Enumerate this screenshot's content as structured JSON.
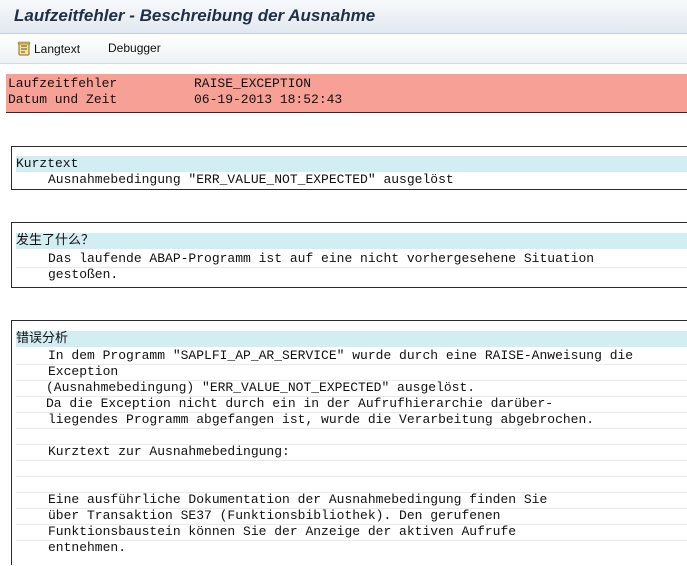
{
  "window": {
    "title": "Laufzeitfehler - Beschreibung der Ausnahme"
  },
  "toolbar": {
    "langtext_label": "Langtext",
    "debugger_label": "Debugger",
    "langtext_icon": "document-scroll-icon"
  },
  "header": {
    "runtime_error_label": "Laufzeitfehler",
    "runtime_error_value": "RAISE_EXCEPTION",
    "date_label": "Datum und Zeit",
    "date_value": "06-19-2013 18:52:43",
    "background_color": "#f7a096"
  },
  "sections": {
    "short_text": {
      "title": "Kurztext",
      "lines": [
        "Ausnahmebedingung \"ERR_VALUE_NOT_EXPECTED\" ausgelöst"
      ]
    },
    "what_happened": {
      "title": "发生了什么？",
      "lines": [
        "Das laufende ABAP-Programm ist auf eine nicht vorhergesehene Situation",
        "gestoßen."
      ]
    },
    "error_analysis": {
      "title": "错误分析",
      "lines": [
        "In dem Programm \"SAPLFI_AP_AR_SERVICE\" wurde durch eine RAISE-Anweisung die",
        " Exception",
        "(Ausnahmebedingung) \"ERR_VALUE_NOT_EXPECTED\" ausgelöst.",
        "Da die Exception nicht durch ein in der Aufrufhierarchie darüber-",
        "liegendes Programm abgefangen ist, wurde die Verarbeitung abgebrochen.",
        "",
        "Kurztext zur Ausnahmebedingung:",
        "",
        "",
        "Eine ausführliche Dokumentation der Ausnahmebedingung finden Sie",
        "über Transaktion SE37 (Funktionsbibliothek). Den gerufenen",
        "Funktionsbaustein können Sie der Anzeige der aktiven Aufrufe",
        "entnehmen."
      ]
    }
  },
  "colors": {
    "section_title_bg": "#d3eef2",
    "title_text": "#1f2f44"
  }
}
